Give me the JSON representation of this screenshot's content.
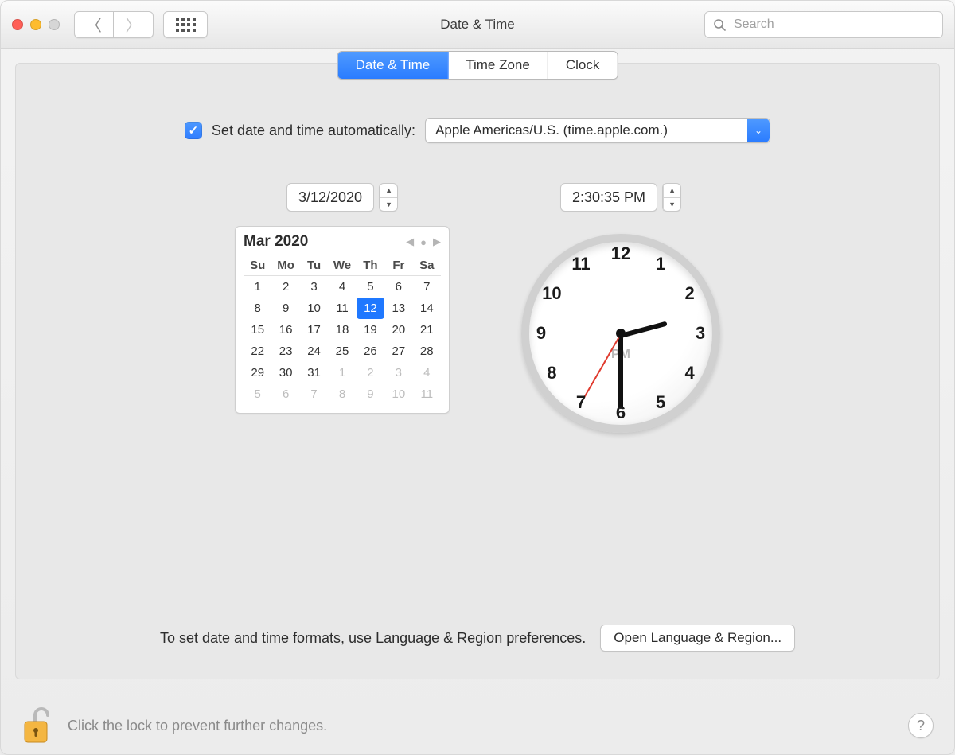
{
  "window_title": "Date & Time",
  "search_placeholder": "Search",
  "tabs": {
    "date_time": "Date & Time",
    "time_zone": "Time Zone",
    "clock": "Clock"
  },
  "auto": {
    "checked": true,
    "label": "Set date and time automatically:",
    "server": "Apple Americas/U.S. (time.apple.com.)"
  },
  "date_field": "3/12/2020",
  "time_field": "2:30:35 PM",
  "calendar": {
    "title": "Mar 2020",
    "dow": [
      "Su",
      "Mo",
      "Tu",
      "We",
      "Th",
      "Fr",
      "Sa"
    ],
    "days": [
      {
        "n": 1
      },
      {
        "n": 2
      },
      {
        "n": 3
      },
      {
        "n": 4
      },
      {
        "n": 5
      },
      {
        "n": 6
      },
      {
        "n": 7
      },
      {
        "n": 8
      },
      {
        "n": 9
      },
      {
        "n": 10
      },
      {
        "n": 11
      },
      {
        "n": 12,
        "sel": true
      },
      {
        "n": 13
      },
      {
        "n": 14
      },
      {
        "n": 15
      },
      {
        "n": 16
      },
      {
        "n": 17
      },
      {
        "n": 18
      },
      {
        "n": 19
      },
      {
        "n": 20
      },
      {
        "n": 21
      },
      {
        "n": 22
      },
      {
        "n": 23
      },
      {
        "n": 24
      },
      {
        "n": 25
      },
      {
        "n": 26
      },
      {
        "n": 27
      },
      {
        "n": 28
      },
      {
        "n": 29
      },
      {
        "n": 30
      },
      {
        "n": 31
      },
      {
        "n": 1,
        "other": true
      },
      {
        "n": 2,
        "other": true
      },
      {
        "n": 3,
        "other": true
      },
      {
        "n": 4,
        "other": true
      },
      {
        "n": 5,
        "other": true
      },
      {
        "n": 6,
        "other": true
      },
      {
        "n": 7,
        "other": true
      },
      {
        "n": 8,
        "other": true
      },
      {
        "n": 9,
        "other": true
      },
      {
        "n": 10,
        "other": true
      },
      {
        "n": 11,
        "other": true
      }
    ]
  },
  "clock": {
    "pm_label": "PM",
    "numbers": [
      "12",
      "1",
      "2",
      "3",
      "4",
      "5",
      "6",
      "7",
      "8",
      "9",
      "10",
      "11"
    ],
    "hour_angle": -15,
    "minute_angle": 90,
    "second_angle": 120
  },
  "format_hint": "To set date and time formats, use Language & Region preferences.",
  "open_region_button": "Open Language & Region...",
  "lock_hint": "Click the lock to prevent further changes.",
  "help": "?"
}
